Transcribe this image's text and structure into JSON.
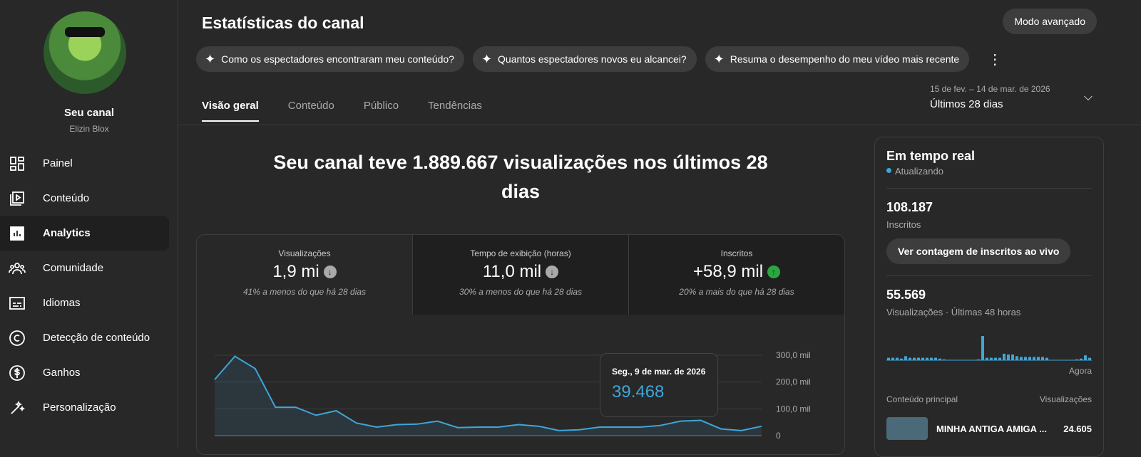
{
  "sidebar": {
    "channel_title": "Seu canal",
    "channel_name": "Elizin Blox",
    "items": [
      {
        "label": "Painel",
        "icon": "dashboard-icon"
      },
      {
        "label": "Conteúdo",
        "icon": "video-library-icon"
      },
      {
        "label": "Analytics",
        "icon": "analytics-icon",
        "active": true
      },
      {
        "label": "Comunidade",
        "icon": "community-icon"
      },
      {
        "label": "Idiomas",
        "icon": "subtitles-icon"
      },
      {
        "label": "Detecção de conteúdo",
        "icon": "copyright-icon"
      },
      {
        "label": "Ganhos",
        "icon": "dollar-icon"
      },
      {
        "label": "Personalização",
        "icon": "magic-wand-icon"
      }
    ]
  },
  "header": {
    "title": "Estatísticas do canal",
    "advanced_button": "Modo avançado",
    "chips": [
      "Como os espectadores encontraram meu conteúdo?",
      "Quantos espectadores novos eu alcancei?",
      "Resuma o desempenho do meu vídeo mais recente"
    ],
    "tabs": [
      "Visão geral",
      "Conteúdo",
      "Público",
      "Tendências"
    ],
    "date_range": "15 de fev. – 14 de mar. de 2026",
    "period": "Últimos 28 dias"
  },
  "summary": {
    "headline": "Seu canal teve 1.889.667 visualizações nos últimos 28 dias"
  },
  "metrics": [
    {
      "label": "Visualizações",
      "value": "1,9 mi",
      "trend": "down",
      "comparison": "41% a menos do que há 28 dias"
    },
    {
      "label": "Tempo de exibição (horas)",
      "value": "11,0 mil",
      "trend": "down",
      "comparison": "30% a menos do que há 28 dias"
    },
    {
      "label": "Inscritos",
      "value": "+58,9 mil",
      "trend": "up",
      "comparison": "20% a mais do que há 28 dias"
    }
  ],
  "chart_data": {
    "type": "area",
    "title": "Visualizações",
    "y_ticks": [
      "300,0 mil",
      "200,0 mil",
      "100,0 mil",
      "0"
    ],
    "ylim": [
      0,
      300000
    ],
    "values": [
      209000,
      296000,
      250000,
      106000,
      106000,
      76000,
      93000,
      47000,
      32000,
      41000,
      43000,
      54000,
      30000,
      32000,
      32000,
      41000,
      35000,
      19000,
      22000,
      32000,
      32000,
      32000,
      38000,
      54000,
      57000,
      25000,
      19000,
      35000
    ],
    "color": "#3ea6d8",
    "tooltip": {
      "date": "Seg., 9 de mar. de 2026",
      "value": "39.468"
    }
  },
  "realtime": {
    "title": "Em tempo real",
    "status": "Atualizando",
    "subscribers": "108.187",
    "subscribers_label": "Inscritos",
    "live_button": "Ver contagem de inscritos ao vivo",
    "views": "55.569",
    "views_label": "Visualizações · Últimas 48 horas",
    "now_label": "Agora",
    "bars": [
      3,
      3,
      3,
      2,
      5,
      3,
      3,
      3,
      3,
      3,
      3,
      3,
      2,
      1,
      0,
      0,
      0,
      0,
      0,
      0,
      0,
      1,
      30,
      3,
      3,
      3,
      3,
      8,
      7,
      7,
      5,
      4,
      4,
      4,
      4,
      4,
      4,
      3,
      0,
      0,
      0,
      0,
      0,
      0,
      1,
      2,
      6,
      3
    ],
    "top_content_label": "Conteúdo principal",
    "views_col_label": "Visualizações",
    "top_video": {
      "title": "MINHA ANTIGA AMIGA ...",
      "views": "24.605"
    }
  }
}
